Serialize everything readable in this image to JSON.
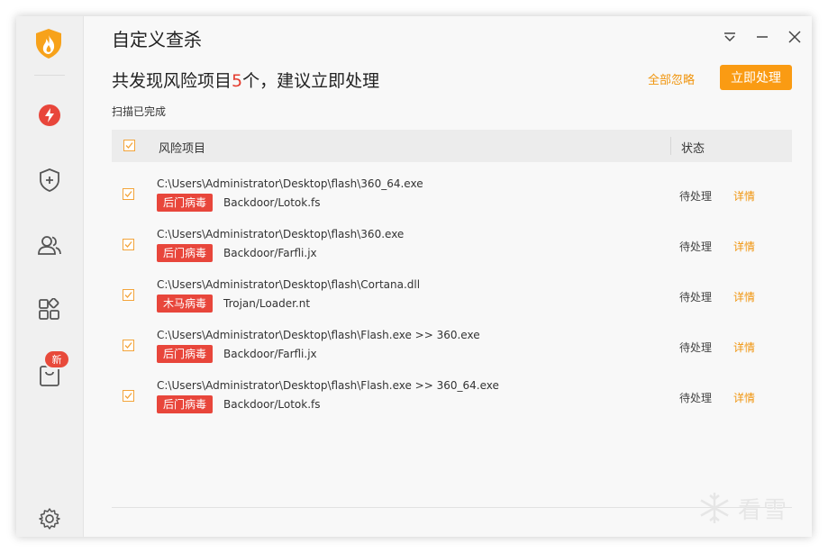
{
  "window": {
    "title": "自定义查杀",
    "controls": {
      "menu_icon": "dropdown-menu-icon",
      "minimize_icon": "minimize-icon",
      "close_icon": "close-icon"
    }
  },
  "sidebar": {
    "logo_icon": "flame-shield-logo",
    "items": [
      {
        "icon": "lightning-icon",
        "active": true
      },
      {
        "icon": "shield-plus-icon"
      },
      {
        "icon": "users-icon"
      },
      {
        "icon": "apps-grid-icon"
      },
      {
        "icon": "bag-icon",
        "badge": "新"
      }
    ],
    "settings_icon": "gear-icon"
  },
  "header": {
    "headline_prefix": "共发现风险项目",
    "headline_count": "5",
    "headline_suffix": "个，建议立即处理",
    "ignore_all": "全部忽略",
    "handle_now": "立即处理",
    "scan_status": "扫描已完成"
  },
  "table": {
    "columns": [
      "风险项目",
      "状态"
    ],
    "rows": [
      {
        "path": "C:\\Users\\Administrator\\Desktop\\flash\\360_64.exe",
        "tag": "后门病毒",
        "virus": "Backdoor/Lotok.fs",
        "status": "待处理",
        "detail": "详情"
      },
      {
        "path": "C:\\Users\\Administrator\\Desktop\\flash\\360.exe",
        "tag": "后门病毒",
        "virus": "Backdoor/Farfli.jx",
        "status": "待处理",
        "detail": "详情"
      },
      {
        "path": "C:\\Users\\Administrator\\Desktop\\flash\\Cortana.dll",
        "tag": "木马病毒",
        "virus": "Trojan/Loader.nt",
        "status": "待处理",
        "detail": "详情"
      },
      {
        "path": "C:\\Users\\Administrator\\Desktop\\flash\\Flash.exe >> 360.exe",
        "tag": "后门病毒",
        "virus": "Backdoor/Farfli.jx",
        "status": "待处理",
        "detail": "详情"
      },
      {
        "path": "C:\\Users\\Administrator\\Desktop\\flash\\Flash.exe >> 360_64.exe",
        "tag": "后门病毒",
        "virus": "Backdoor/Lotok.fs",
        "status": "待处理",
        "detail": "详情"
      }
    ]
  },
  "watermark": {
    "text": "看雪",
    "icon": "snowflake-icon"
  },
  "colors": {
    "accent": "#fa9b13",
    "link": "#f0950e",
    "danger": "#e8463b",
    "count": "#e43c2f"
  }
}
